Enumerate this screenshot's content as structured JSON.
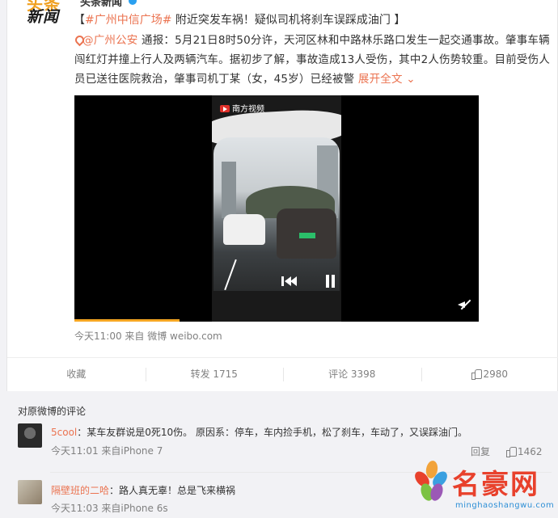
{
  "post": {
    "logo_line1": "头条",
    "logo_line2": "新闻",
    "author": "头条新闻",
    "headline_open": "【",
    "topic": "#广州中信广场#",
    "headline_text": " 附近突发车祸！疑似司机将刹车误踩成油门",
    "headline_close": " 】",
    "mention": "@广州公安",
    "body": " 通报：5月21日8时50分许，天河区林和中路林乐路口发生一起交通事故。肇事车辆闯红灯并撞上行人及两辆汽车。据初步了解，事故造成13人受伤，其中2人伤势较重。目前受伤人员已送往医院救治，肇事司机丁某（女，45岁）已经被警",
    "expand": "展开全文",
    "video_brand": "南方视频",
    "video_progress": 0.26,
    "meta": "今天11:00 来自 微博 weibo.com"
  },
  "actions": {
    "collect": "收藏",
    "repost": "转发 1715",
    "comment": "评论 3398",
    "like": "2980"
  },
  "comments": {
    "header": "对原微博的评论",
    "items": [
      {
        "user": "5cool",
        "text": "：某车友群说是0死10伤。 原因系：停车，车内捡手机，松了刹车，车动了，又误踩油门。",
        "meta": "今天11:01 来自iPhone 7",
        "reply": "回复",
        "likes": "1462"
      },
      {
        "user": "隔壁班的二哈",
        "text": "：路人真无辜！总是飞来横祸",
        "meta": "今天11:03 来自iPhone 6s"
      }
    ]
  },
  "watermark": {
    "title": "名豪网",
    "url": "minghaoshangwu.com"
  },
  "colors": {
    "accent": "#eb7350",
    "meta": "#808080",
    "progress": "#f5a623"
  }
}
